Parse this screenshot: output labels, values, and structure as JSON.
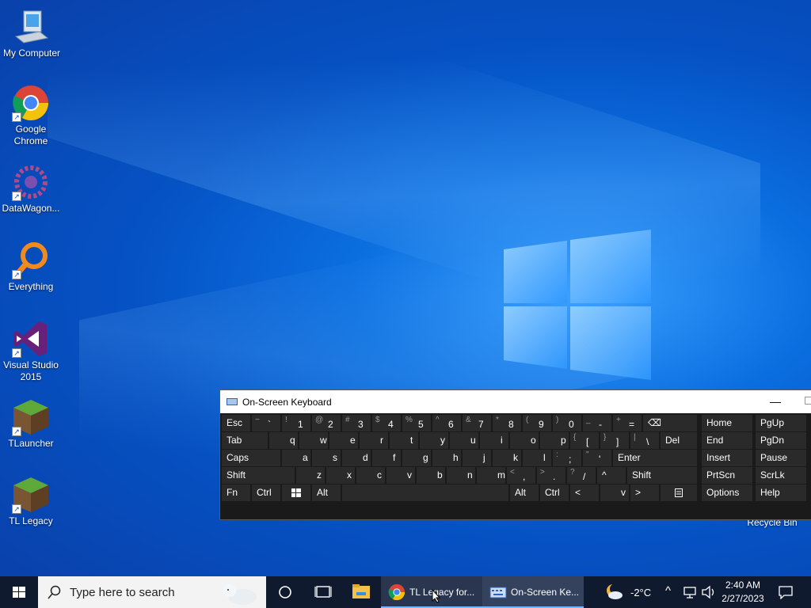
{
  "desktop": {
    "icons": [
      {
        "label": "My Computer",
        "icon": "computer-icon"
      },
      {
        "label": "Google Chrome",
        "icon": "chrome-icon"
      },
      {
        "label": "DataWagon...",
        "icon": "datawagon-icon"
      },
      {
        "label": "Everything",
        "icon": "everything-search-icon"
      },
      {
        "label": "Visual Studio 2015",
        "icon": "visual-studio-icon"
      },
      {
        "label": "TLauncher",
        "icon": "minecraft-block-icon"
      },
      {
        "label": "TL Legacy",
        "icon": "minecraft-block-icon"
      }
    ],
    "recycle_bin": "Recycle Bin"
  },
  "osk": {
    "title": "On-Screen Keyboard",
    "row1": [
      "Esc",
      "~ `",
      "! 1",
      "@ 2",
      "# 3",
      "$ 4",
      "% 5",
      "^ 6",
      "& 7",
      "* 8",
      "( 9",
      ") 0",
      "_ -",
      "+ =",
      "⌫",
      "Home",
      "PgUp"
    ],
    "row2": [
      "Tab",
      "q",
      "w",
      "e",
      "r",
      "t",
      "y",
      "u",
      "i",
      "o",
      "p",
      "{ [",
      "} ]",
      "| \\",
      "Del",
      "End",
      "PgDn"
    ],
    "row3": [
      "Caps",
      "a",
      "s",
      "d",
      "f",
      "g",
      "h",
      "j",
      "k",
      "l",
      ": ;",
      "\" '",
      "Enter",
      "Insert",
      "Pause"
    ],
    "row4": [
      "Shift",
      "z",
      "x",
      "c",
      "v",
      "b",
      "n",
      "m",
      "< ,",
      "> .",
      "? /",
      "^",
      "Shift",
      "PrtScn",
      "ScrLk"
    ],
    "row5": [
      "Fn",
      "Ctrl",
      "win",
      "Alt",
      "",
      "Alt",
      "Ctrl",
      "<",
      "v",
      ">",
      "menu",
      "Options",
      "Help"
    ]
  },
  "taskbar": {
    "search_placeholder": "Type here to search",
    "apps": [
      {
        "label": "TL Legacy for...",
        "icon": "chrome-icon"
      },
      {
        "label": "On-Screen Ke...",
        "icon": "keyboard-icon"
      }
    ],
    "weather": "-2°C",
    "time": "2:40 AM",
    "date": "2/27/2023"
  },
  "colors": {
    "taskbar_bg": "#101a2e",
    "osk_bg": "#1f1f1f",
    "key_bg": "#2a2a2a",
    "accent": "#7bb5ff"
  }
}
